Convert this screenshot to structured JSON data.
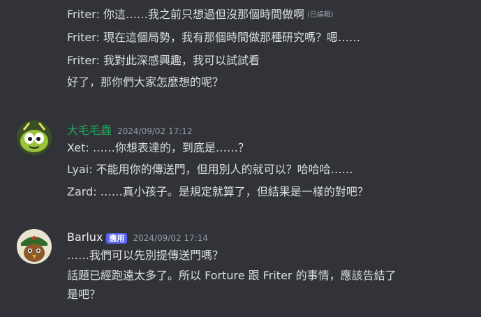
{
  "messages": [
    {
      "continuation_lines": [
        "Friter: 你這……我之前只想過但沒那個時間做啊",
        "Friter: 現在這個局勢，我有那個時間做那種研究嗎？嗯……",
        "Friter: 我對此深感興趣，我可以試試看",
        "好了，那你們大家怎麼想的呢？"
      ],
      "edited_label": "(已編輯)"
    },
    {
      "author": "大毛毛蟲",
      "author_color": "#23a55a",
      "timestamp": "2024/09/02 17:12",
      "avatar_icon": "green-caterpillar-avatar",
      "lines": [
        "Xet: ……你想表達的，到底是……？",
        "Lyai: 不能用你的傳送門，但用別人的就可以？哈哈哈……",
        "Zard: ……真小孩子。是規定就算了，但結果是一樣的對吧？"
      ]
    },
    {
      "author": "Barlux",
      "author_color": "#f2f3f5",
      "badge": "應用",
      "badge_color": "#5865f2",
      "timestamp": "2024/09/02 17:14",
      "avatar_icon": "bird-soldier-avatar",
      "lines": [
        "……我們可以先別提傳送門嗎？",
        "話題已經跑遠太多了。所以 Forture 跟 Friter 的事情，應該告結了",
        "是吧？"
      ]
    }
  ]
}
